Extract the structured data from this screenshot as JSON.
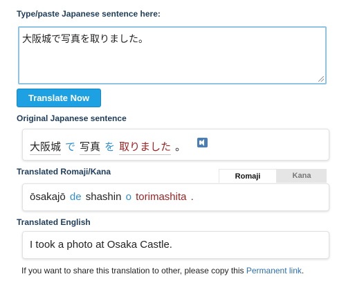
{
  "input_section": {
    "label": "Type/paste Japanese sentence here:",
    "value": "大阪城で写真を取りました。"
  },
  "translate_button": {
    "label": "Translate Now"
  },
  "original": {
    "label": "Original Japanese sentence",
    "tokens": [
      {
        "text": "大阪城",
        "type": "noun"
      },
      {
        "text": "で",
        "type": "particle"
      },
      {
        "text": "写真",
        "type": "noun"
      },
      {
        "text": "を",
        "type": "particle"
      },
      {
        "text": "取りました",
        "type": "verb"
      },
      {
        "text": "。",
        "type": "punct"
      }
    ],
    "audio_icon": "speaker-icon"
  },
  "romaji": {
    "label": "Translated Romaji/Kana",
    "tabs": [
      {
        "label": "Romaji",
        "active": true
      },
      {
        "label": "Kana",
        "active": false
      }
    ],
    "tokens": [
      {
        "text": "ōsakajō",
        "type": "noun"
      },
      {
        "text": "de",
        "type": "particle"
      },
      {
        "text": "shashin",
        "type": "noun"
      },
      {
        "text": "o",
        "type": "particle"
      },
      {
        "text": "torimashita",
        "type": "verb"
      },
      {
        "text": ".",
        "type": "punct"
      }
    ]
  },
  "english": {
    "label": "Translated English",
    "value": "I took a photo at Osaka Castle."
  },
  "footer": {
    "text": "If you want to share this translation to other, please copy this ",
    "link": "Permanent link",
    "end": "."
  },
  "colors": {
    "accent": "#1da1e3",
    "label": "#1e3c5a",
    "particle": "#2f8fd1",
    "verb": "#9e1f1f",
    "link": "#2e6fb0"
  }
}
